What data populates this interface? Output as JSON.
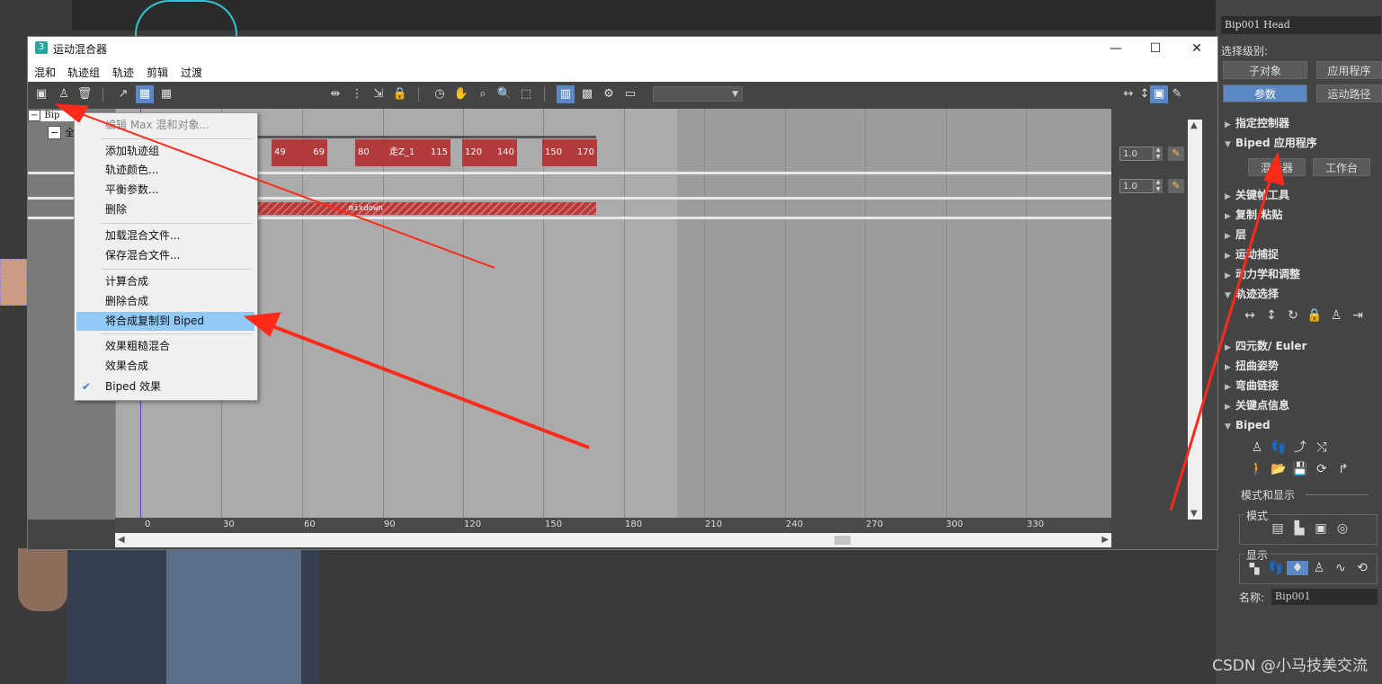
{
  "window": {
    "title": "运动混合器",
    "app_icon": "3",
    "controls": {
      "minimize": "—",
      "maximize": "☐",
      "close": "✕"
    }
  },
  "menubar": [
    "混和",
    "轨迹组",
    "轨迹",
    "剪辑",
    "过渡"
  ],
  "context_menu": {
    "items": [
      {
        "label": "编辑 Max 混和对象...",
        "disabled": true
      },
      {
        "label": "添加轨迹组"
      },
      {
        "label": "轨迹颜色..."
      },
      {
        "label": "平衡参数..."
      },
      {
        "label": "删除"
      },
      {
        "label": "加载混合文件..."
      },
      {
        "label": "保存混合文件..."
      },
      {
        "label": "计算合成"
      },
      {
        "label": "删除合成"
      },
      {
        "label": "将合成复制到 Biped",
        "highlighted": true
      },
      {
        "label": "效果粗糙混合"
      },
      {
        "label": "效果合成"
      },
      {
        "label": "Biped 效果",
        "checked": true
      }
    ]
  },
  "tracks": {
    "root_label": "Bip",
    "group_label": "全",
    "clips": [
      {
        "start": "49",
        "end": "69",
        "name": ""
      },
      {
        "start": "80",
        "end": "115",
        "name": "走Z_1"
      },
      {
        "start": "120",
        "end": "140",
        "name": ""
      },
      {
        "start": "150",
        "end": "170",
        "name": ""
      }
    ],
    "mixdown_label": "mixdown",
    "weight_1": "1.0",
    "weight_2": "1.0"
  },
  "ruler": [
    "0",
    "30",
    "60",
    "90",
    "120",
    "150",
    "180",
    "210",
    "240",
    "270",
    "300",
    "330"
  ],
  "panel": {
    "object_name": "Bip001 Head",
    "selection_level_label": "选择级别:",
    "sub_object_btn": "子对象",
    "app_btn": "应用程序",
    "params_btn": "参数",
    "motion_path_btn": "运动路径",
    "rollouts": [
      {
        "label": "指定控制器",
        "open": false
      },
      {
        "label": "Biped 应用程序",
        "open": true
      },
      {
        "label": "关键帧工具",
        "open": false
      },
      {
        "label": "复制/粘贴",
        "open": false
      },
      {
        "label": "层",
        "open": false
      },
      {
        "label": "运动捕捉",
        "open": false
      },
      {
        "label": "动力学和调整",
        "open": false
      },
      {
        "label": "轨迹选择",
        "open": true
      },
      {
        "label": "四元数/ Euler",
        "open": false
      },
      {
        "label": "扭曲姿势",
        "open": false
      },
      {
        "label": "弯曲链接",
        "open": false
      },
      {
        "label": "关键点信息",
        "open": false
      },
      {
        "label": "Biped",
        "open": true
      }
    ],
    "mixer_btn": "混合器",
    "workbench_btn": "工作台",
    "mode_display_label": "模式和显示",
    "mode_label": "模式",
    "display_label": "显示",
    "name_label": "名称:",
    "name_value": "Bip001"
  },
  "watermark": "CSDN @小马技美交流",
  "colors": {
    "clip": "#b23a3a",
    "highlight": "#91c9f7",
    "active_button": "#5b87c4",
    "arrow": "#ff2a1a"
  }
}
